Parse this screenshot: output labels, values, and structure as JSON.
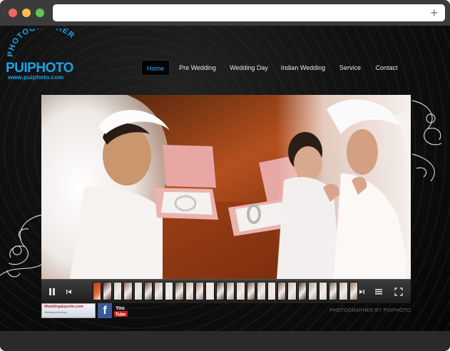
{
  "browser": {
    "new_tab_icon": "plus-icon"
  },
  "logo": {
    "arc_text": "PHOTOGRAPHER",
    "brand": "PUIPHOTO",
    "url": "www.puiphoto.com",
    "color": "#1aa3e8"
  },
  "nav": {
    "items": [
      {
        "label": "Home",
        "active": true
      },
      {
        "label": "Pre Wedding",
        "active": false
      },
      {
        "label": "Wedding Day",
        "active": false
      },
      {
        "label": "Indian Wedding",
        "active": false
      },
      {
        "label": "Service",
        "active": false
      },
      {
        "label": "Contact",
        "active": false
      }
    ],
    "active_color": "#3aa6ff"
  },
  "player": {
    "controls": [
      "pause-icon",
      "previous-icon",
      "next-icon",
      "playlist-icon",
      "fullscreen-icon"
    ],
    "thumbnail_count": 26
  },
  "footer": {
    "badge_wedding_title": "Wedding&quote.com",
    "badge_wedding_sub": "Wedding directory",
    "facebook_label": "f",
    "youtube_label": "You Tube",
    "credit": "PHOTOGRAPHER BY PUIPHOTO"
  }
}
